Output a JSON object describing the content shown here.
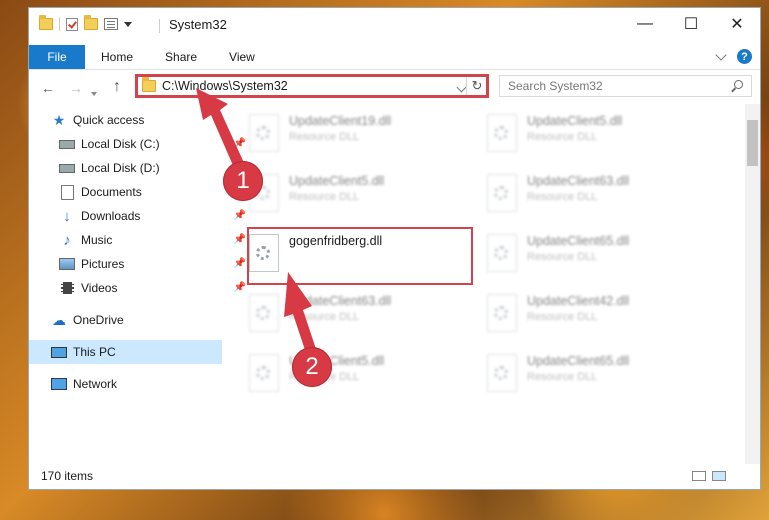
{
  "window": {
    "title": "System32",
    "controls": {
      "minimize": "—",
      "maximize": "☐",
      "close": "✕"
    }
  },
  "ribbon": {
    "tabs": [
      "File",
      "Home",
      "Share",
      "View"
    ],
    "help": "?"
  },
  "nav": {
    "address": "C:\\Windows\\System32",
    "search_placeholder": "Search System32"
  },
  "sidebar": {
    "items": [
      {
        "label": "Quick access",
        "icon": "star-icon"
      },
      {
        "label": "Local Disk (C:)",
        "icon": "drive-icon",
        "pinned": true
      },
      {
        "label": "Local Disk (D:)",
        "icon": "drive-icon",
        "pinned": true
      },
      {
        "label": "Documents",
        "icon": "documents-icon",
        "pinned": true
      },
      {
        "label": "Downloads",
        "icon": "download-icon",
        "pinned": true
      },
      {
        "label": "Music",
        "icon": "music-icon",
        "pinned": true
      },
      {
        "label": "Pictures",
        "icon": "pictures-icon",
        "pinned": true
      },
      {
        "label": "Videos",
        "icon": "videos-icon",
        "pinned": true
      },
      {
        "label": "OneDrive",
        "icon": "cloud-icon"
      },
      {
        "label": "This PC",
        "icon": "pc-icon",
        "selected": true
      },
      {
        "label": "Network",
        "icon": "network-icon"
      }
    ]
  },
  "files": [
    {
      "name": "UpdateClient19.dll",
      "type": "Resource DLL"
    },
    {
      "name": "UpdateClient5.dll",
      "type": "Resource DLL"
    },
    {
      "name": "UpdateClient5.dll",
      "type": "Resource DLL"
    },
    {
      "name": "UpdateClient63.dll",
      "type": "Resource DLL"
    },
    {
      "name": "gogenfridberg.dll",
      "type": ""
    },
    {
      "name": "UpdateClient65.dll",
      "type": "Resource DLL"
    },
    {
      "name": "UpdateClient63.dll",
      "type": "Resource DLL"
    },
    {
      "name": "UpdateClient42.dll",
      "type": "Resource DLL"
    },
    {
      "name": "UpdateClient5.dll",
      "type": "Resource DLL"
    },
    {
      "name": "UpdateClient65.dll",
      "type": "Resource DLL"
    }
  ],
  "status": {
    "count": "170 items"
  },
  "annotations": {
    "step1": "1",
    "step2": "2"
  },
  "colors": {
    "accent": "#1979ca",
    "highlight": "#d2434b",
    "selected": "#cce8ff"
  }
}
